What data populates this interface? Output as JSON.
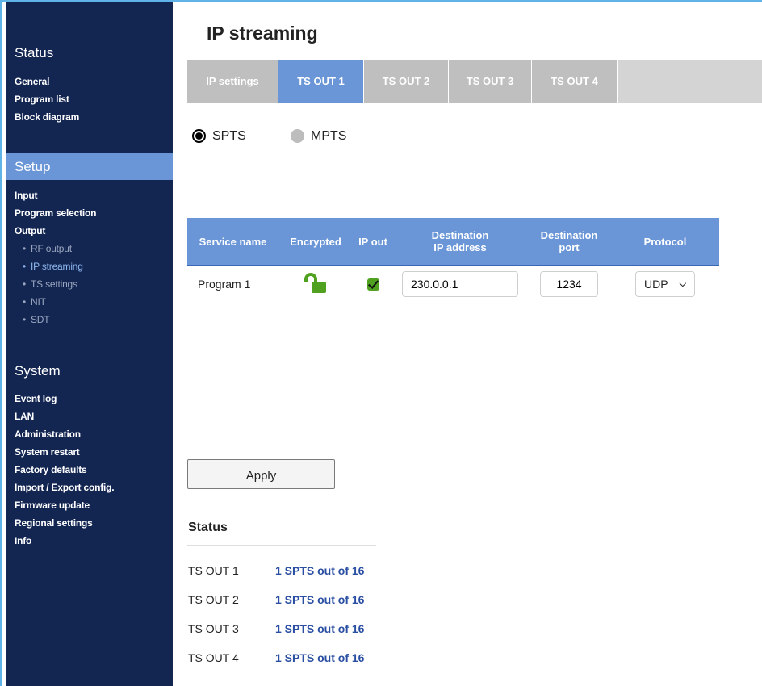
{
  "sidebar": {
    "status_heading": "Status",
    "status_items": [
      "General",
      "Program list",
      "Block diagram"
    ],
    "setup_heading": "Setup",
    "setup_items": [
      "Input",
      "Program selection",
      "Output"
    ],
    "output_subitems": [
      "RF output",
      "IP streaming",
      "TS settings",
      "NIT",
      "SDT"
    ],
    "active_subitem": "IP streaming",
    "system_heading": "System",
    "system_items": [
      "Event log",
      "LAN",
      "Administration",
      "System restart",
      "Factory defaults",
      "Import / Export config.",
      "Firmware update",
      "Regional settings",
      "Info"
    ]
  },
  "page": {
    "title": "IP streaming"
  },
  "tabs": [
    "IP settings",
    "TS OUT 1",
    "TS OUT 2",
    "TS OUT 3",
    "TS OUT 4"
  ],
  "active_tab": "TS OUT 1",
  "mode": {
    "options": [
      "SPTS",
      "MPTS"
    ],
    "selected": "SPTS"
  },
  "table": {
    "headers": {
      "service_name": "Service name",
      "encrypted": "Encrypted",
      "ip_out": "IP out",
      "dest_ip_line1": "Destination",
      "dest_ip_line2": "IP address",
      "dest_port_line1": "Destination",
      "dest_port_line2": "port",
      "protocol": "Protocol"
    },
    "rows": [
      {
        "service_name": "Program 1",
        "encrypted_icon": "unlocked-padlock-icon",
        "ip_out": true,
        "dest_ip": "230.0.0.1",
        "dest_port": "1234",
        "protocol": "UDP"
      }
    ]
  },
  "apply_label": "Apply",
  "status": {
    "title": "Status",
    "rows": [
      {
        "label": "TS OUT 1",
        "value": "1 SPTS out of 16"
      },
      {
        "label": "TS OUT 2",
        "value": "1 SPTS out of 16"
      },
      {
        "label": "TS OUT 3",
        "value": "1 SPTS out of 16"
      },
      {
        "label": "TS OUT 4",
        "value": "1 SPTS out of 16"
      }
    ]
  },
  "colors": {
    "sidebar_bg": "#132652",
    "accent": "#6a96d7",
    "tab_inactive": "#bfbfbf",
    "status_value": "#2a4fa2",
    "lock_green": "#4fa11f"
  }
}
